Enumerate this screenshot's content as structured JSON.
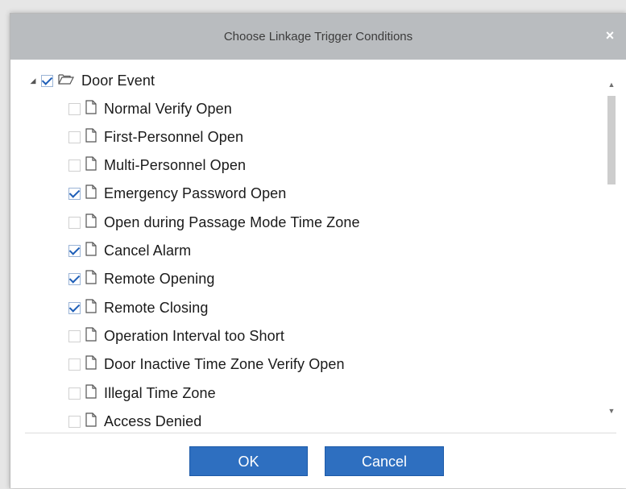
{
  "dialog": {
    "title": "Choose Linkage Trigger Conditions",
    "close_label": "×"
  },
  "tree": {
    "root": {
      "label": "Door Event",
      "checked": true,
      "expanded": true
    },
    "items": [
      {
        "label": "Normal Verify Open",
        "checked": false
      },
      {
        "label": "First-Personnel Open",
        "checked": false
      },
      {
        "label": "Multi-Personnel Open",
        "checked": false
      },
      {
        "label": "Emergency Password Open",
        "checked": true
      },
      {
        "label": "Open during Passage Mode Time Zone",
        "checked": false
      },
      {
        "label": "Cancel Alarm",
        "checked": true
      },
      {
        "label": "Remote Opening",
        "checked": true
      },
      {
        "label": "Remote Closing",
        "checked": true
      },
      {
        "label": "Operation Interval too Short",
        "checked": false
      },
      {
        "label": "Door Inactive Time Zone Verify Open",
        "checked": false
      },
      {
        "label": "Illegal Time Zone",
        "checked": false
      },
      {
        "label": "Access Denied",
        "checked": false
      }
    ]
  },
  "buttons": {
    "ok_label": "OK",
    "cancel_label": "Cancel"
  },
  "colors": {
    "titlebar": "#b9bcbf",
    "button": "#2e6fc0",
    "check": "#1f5fb8"
  }
}
